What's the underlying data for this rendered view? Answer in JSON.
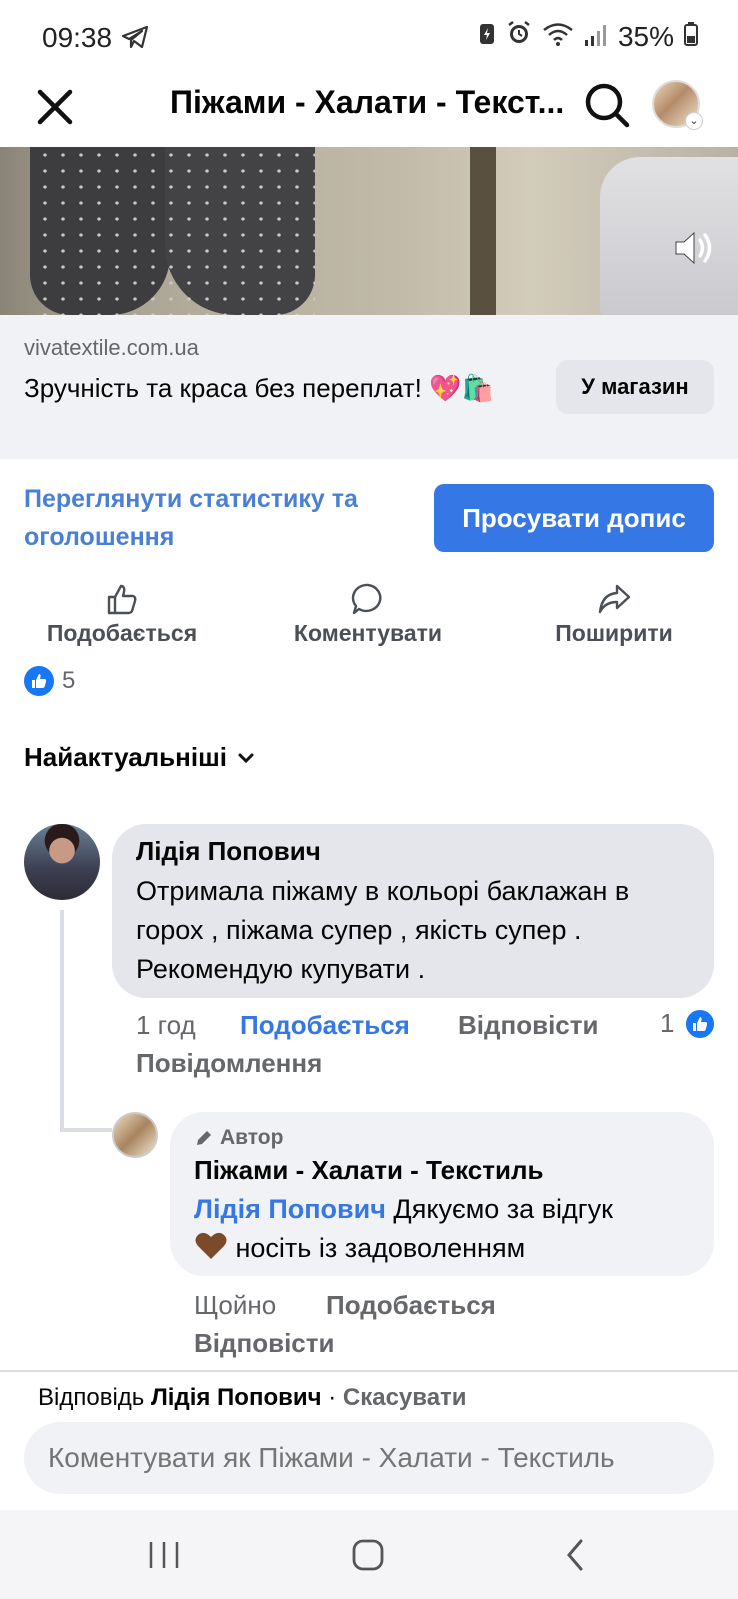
{
  "status_bar": {
    "time": "09:38",
    "battery": "35%"
  },
  "header": {
    "title": "Піжами - Халати - Текст..."
  },
  "link_card": {
    "domain": "vivatextile.com.ua",
    "title": "Зручність та краса без переплат! 💖🛍️",
    "button": "У магазин"
  },
  "promo": {
    "stats_link": "Переглянути статистику та оголошення",
    "promote_button": "Просувати допис"
  },
  "actions": {
    "like": "Подобається",
    "comment": "Коментувати",
    "share": "Поширити"
  },
  "reactions": {
    "count": "5"
  },
  "sort": {
    "label": "Найактуальніші"
  },
  "comment1": {
    "author": "Лідія Попович",
    "text": "Отримала піжаму в кольорі баклажан в горох , піжама супер , якість супер . Рекомендую купувати .",
    "time": "1 год",
    "like": "Подобається",
    "reply": "Відповісти",
    "like_count": "1",
    "message": "Повідомлення"
  },
  "comment2": {
    "badge": "Автор",
    "author": "Піжами - Халати - Текстиль",
    "mention": "Лідія Попович",
    "text": " Дякуємо за відгук",
    "text2": " носіть із задоволенням",
    "time": "Щойно",
    "like": "Подобається",
    "reply": "Відповісти"
  },
  "reply_bar": {
    "prefix": "Відповідь ",
    "name": "Лідія Попович",
    "sep": " · ",
    "cancel": "Скасувати",
    "placeholder": "Коментувати як Піжами - Халати - Текстиль"
  },
  "colors": {
    "accent": "#3578e5",
    "like_blue": "#1877f2",
    "bubble": "#e4e6eb",
    "muted": "#65676b"
  }
}
